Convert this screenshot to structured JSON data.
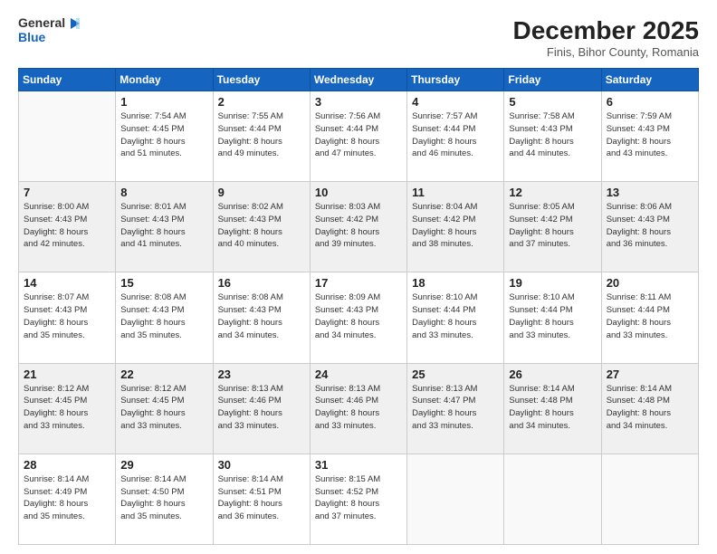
{
  "header": {
    "logo_line1": "General",
    "logo_line2": "Blue",
    "main_title": "December 2025",
    "subtitle": "Finis, Bihor County, Romania"
  },
  "days_of_week": [
    "Sunday",
    "Monday",
    "Tuesday",
    "Wednesday",
    "Thursday",
    "Friday",
    "Saturday"
  ],
  "weeks": [
    [
      {
        "day": "",
        "info": ""
      },
      {
        "day": "1",
        "info": "Sunrise: 7:54 AM\nSunset: 4:45 PM\nDaylight: 8 hours\nand 51 minutes."
      },
      {
        "day": "2",
        "info": "Sunrise: 7:55 AM\nSunset: 4:44 PM\nDaylight: 8 hours\nand 49 minutes."
      },
      {
        "day": "3",
        "info": "Sunrise: 7:56 AM\nSunset: 4:44 PM\nDaylight: 8 hours\nand 47 minutes."
      },
      {
        "day": "4",
        "info": "Sunrise: 7:57 AM\nSunset: 4:44 PM\nDaylight: 8 hours\nand 46 minutes."
      },
      {
        "day": "5",
        "info": "Sunrise: 7:58 AM\nSunset: 4:43 PM\nDaylight: 8 hours\nand 44 minutes."
      },
      {
        "day": "6",
        "info": "Sunrise: 7:59 AM\nSunset: 4:43 PM\nDaylight: 8 hours\nand 43 minutes."
      }
    ],
    [
      {
        "day": "7",
        "info": "Sunrise: 8:00 AM\nSunset: 4:43 PM\nDaylight: 8 hours\nand 42 minutes."
      },
      {
        "day": "8",
        "info": "Sunrise: 8:01 AM\nSunset: 4:43 PM\nDaylight: 8 hours\nand 41 minutes."
      },
      {
        "day": "9",
        "info": "Sunrise: 8:02 AM\nSunset: 4:43 PM\nDaylight: 8 hours\nand 40 minutes."
      },
      {
        "day": "10",
        "info": "Sunrise: 8:03 AM\nSunset: 4:42 PM\nDaylight: 8 hours\nand 39 minutes."
      },
      {
        "day": "11",
        "info": "Sunrise: 8:04 AM\nSunset: 4:42 PM\nDaylight: 8 hours\nand 38 minutes."
      },
      {
        "day": "12",
        "info": "Sunrise: 8:05 AM\nSunset: 4:42 PM\nDaylight: 8 hours\nand 37 minutes."
      },
      {
        "day": "13",
        "info": "Sunrise: 8:06 AM\nSunset: 4:43 PM\nDaylight: 8 hours\nand 36 minutes."
      }
    ],
    [
      {
        "day": "14",
        "info": "Sunrise: 8:07 AM\nSunset: 4:43 PM\nDaylight: 8 hours\nand 35 minutes."
      },
      {
        "day": "15",
        "info": "Sunrise: 8:08 AM\nSunset: 4:43 PM\nDaylight: 8 hours\nand 35 minutes."
      },
      {
        "day": "16",
        "info": "Sunrise: 8:08 AM\nSunset: 4:43 PM\nDaylight: 8 hours\nand 34 minutes."
      },
      {
        "day": "17",
        "info": "Sunrise: 8:09 AM\nSunset: 4:43 PM\nDaylight: 8 hours\nand 34 minutes."
      },
      {
        "day": "18",
        "info": "Sunrise: 8:10 AM\nSunset: 4:44 PM\nDaylight: 8 hours\nand 33 minutes."
      },
      {
        "day": "19",
        "info": "Sunrise: 8:10 AM\nSunset: 4:44 PM\nDaylight: 8 hours\nand 33 minutes."
      },
      {
        "day": "20",
        "info": "Sunrise: 8:11 AM\nSunset: 4:44 PM\nDaylight: 8 hours\nand 33 minutes."
      }
    ],
    [
      {
        "day": "21",
        "info": "Sunrise: 8:12 AM\nSunset: 4:45 PM\nDaylight: 8 hours\nand 33 minutes."
      },
      {
        "day": "22",
        "info": "Sunrise: 8:12 AM\nSunset: 4:45 PM\nDaylight: 8 hours\nand 33 minutes."
      },
      {
        "day": "23",
        "info": "Sunrise: 8:13 AM\nSunset: 4:46 PM\nDaylight: 8 hours\nand 33 minutes."
      },
      {
        "day": "24",
        "info": "Sunrise: 8:13 AM\nSunset: 4:46 PM\nDaylight: 8 hours\nand 33 minutes."
      },
      {
        "day": "25",
        "info": "Sunrise: 8:13 AM\nSunset: 4:47 PM\nDaylight: 8 hours\nand 33 minutes."
      },
      {
        "day": "26",
        "info": "Sunrise: 8:14 AM\nSunset: 4:48 PM\nDaylight: 8 hours\nand 34 minutes."
      },
      {
        "day": "27",
        "info": "Sunrise: 8:14 AM\nSunset: 4:48 PM\nDaylight: 8 hours\nand 34 minutes."
      }
    ],
    [
      {
        "day": "28",
        "info": "Sunrise: 8:14 AM\nSunset: 4:49 PM\nDaylight: 8 hours\nand 35 minutes."
      },
      {
        "day": "29",
        "info": "Sunrise: 8:14 AM\nSunset: 4:50 PM\nDaylight: 8 hours\nand 35 minutes."
      },
      {
        "day": "30",
        "info": "Sunrise: 8:14 AM\nSunset: 4:51 PM\nDaylight: 8 hours\nand 36 minutes."
      },
      {
        "day": "31",
        "info": "Sunrise: 8:15 AM\nSunset: 4:52 PM\nDaylight: 8 hours\nand 37 minutes."
      },
      {
        "day": "",
        "info": ""
      },
      {
        "day": "",
        "info": ""
      },
      {
        "day": "",
        "info": ""
      }
    ]
  ]
}
